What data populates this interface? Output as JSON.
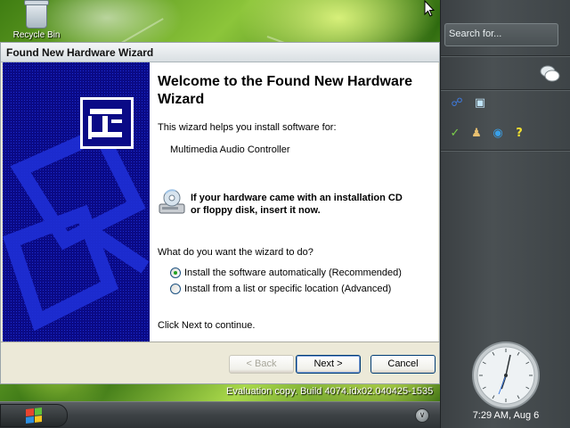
{
  "desktop": {
    "recycle_bin_label": "Recycle Bin",
    "evaluation_text": "Evaluation copy. Build 4074.idx02.040425-1535"
  },
  "wizard": {
    "title": "Found New Hardware Wizard",
    "heading": "Welcome to the Found New Hardware Wizard",
    "intro": "This wizard helps you install software for:",
    "device_name": "Multimedia Audio Controller",
    "cd_notice_line1": "If your hardware came with an installation CD",
    "cd_notice_line2": "or floppy disk, insert it now.",
    "question": "What do you want the wizard to do?",
    "options": [
      {
        "label": "Install the software automatically (Recommended)",
        "checked": true
      },
      {
        "label": "Install from a list or specific location (Advanced)",
        "checked": false
      }
    ],
    "continue_text": "Click Next to continue.",
    "buttons": {
      "back": "< Back",
      "next": "Next >",
      "cancel": "Cancel"
    }
  },
  "sidebar": {
    "search_placeholder": "Search for...",
    "clock_text": "7:29 AM, Aug 6"
  },
  "colors": {
    "wizard_banner": "#0a0a86",
    "sidebar_bg": "#4a5053",
    "accent_blue": "#003c74"
  },
  "icons": {
    "tray": "chevron-down-icon",
    "start": "windows-flag-icon",
    "chat": "chat-bubbles-icon"
  }
}
